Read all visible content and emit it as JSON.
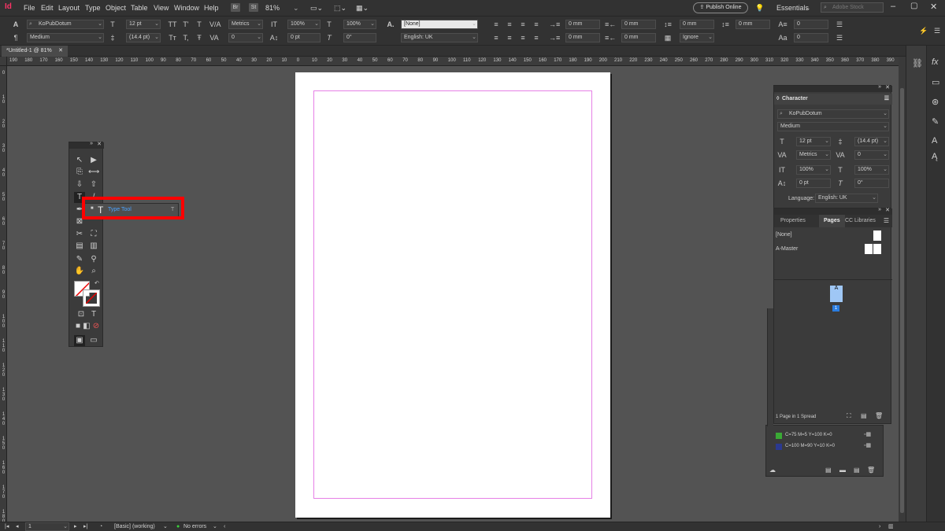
{
  "app": {
    "logo": "Id"
  },
  "menus": [
    "File",
    "Edit",
    "Layout",
    "Type",
    "Object",
    "Table",
    "View",
    "Window",
    "Help"
  ],
  "menubar": {
    "br": "Br",
    "st": "St",
    "zoom": "81%",
    "publish": "Publish Online",
    "workspace": "Essentials",
    "search_placeholder": "Adobe Stock"
  },
  "control": {
    "font": "KoPubDotum",
    "style": "Medium",
    "size": "12 pt",
    "leading": "(14.4 pt)",
    "kerning": "Metrics",
    "tracking": "0",
    "hscale": "100%",
    "vscale": "100%",
    "baseline": "0 pt",
    "skew": "0°",
    "charstyle": "[None]",
    "language": "English: UK",
    "indent1": "0 mm",
    "indent2": "0 mm",
    "indent3": "0 mm",
    "indent4": "0 mm",
    "spacing1": "0 mm",
    "spacing2": "0 mm",
    "hyph": "Ignore",
    "drop1": "0",
    "drop2": "0"
  },
  "doc": {
    "tab": "*Untitled-1 @ 81%"
  },
  "ruler_ticks": [
    "190",
    "180",
    "170",
    "160",
    "150",
    "140",
    "130",
    "120",
    "110",
    "100",
    "90",
    "80",
    "70",
    "60",
    "50",
    "40",
    "30",
    "20",
    "10",
    "0",
    "10",
    "20",
    "30",
    "40",
    "50",
    "60",
    "70",
    "80",
    "90",
    "100",
    "110",
    "120",
    "130",
    "140",
    "150",
    "160",
    "170",
    "180",
    "190",
    "200",
    "210",
    "220",
    "230",
    "240",
    "250",
    "260",
    "270",
    "280",
    "290",
    "300",
    "310",
    "320",
    "330",
    "340",
    "350",
    "360",
    "370",
    "380",
    "390"
  ],
  "vruler_ticks": [
    "0",
    "1 0",
    "2 0",
    "3 0",
    "4 0",
    "5 0",
    "6 0",
    "7 0",
    "8 0",
    "9 0",
    "1 0 0",
    "1 1 0",
    "1 2 0",
    "1 3 0",
    "1 4 0",
    "1 5 0",
    "1 6 0",
    "1 7 0",
    "1 8 0"
  ],
  "flyout": {
    "label": "Type Tool",
    "shortcut": "T"
  },
  "character": {
    "title": "Character",
    "font": "KoPubDotum",
    "style": "Medium",
    "size": "12 pt",
    "leading": "(14.4 pt)",
    "kerning": "Metrics",
    "tracking": "0",
    "hscale": "100%",
    "vscale": "100%",
    "baseline": "0 pt",
    "skew": "0°",
    "language_label": "Language:",
    "language": "English: UK"
  },
  "pages_panel": {
    "tabs": [
      "Properties",
      "Pages",
      "CC Libraries"
    ],
    "none": "[None]",
    "master": "A-Master",
    "page_letter": "A",
    "page_num": "1",
    "footer": "1 Page in 1 Spread"
  },
  "swatches": [
    {
      "label": "C=75 M=5 Y=100 K=0",
      "color": "#3aa935"
    },
    {
      "label": "C=100 M=90 Y=10 K=0",
      "color": "#2b3990"
    }
  ],
  "status": {
    "page": "1",
    "style": "[Basic] (working)",
    "errors": "No errors"
  }
}
